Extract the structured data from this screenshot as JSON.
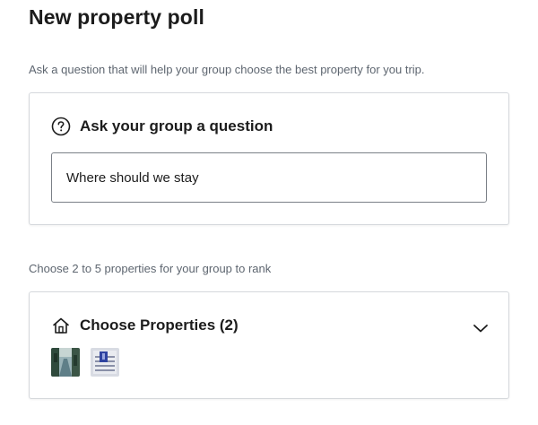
{
  "page": {
    "title": "New property poll",
    "subtitle": "Ask a question that will help your group choose the best property for you trip."
  },
  "question_card": {
    "heading": "Ask your group a question",
    "icon": "question-circle-icon",
    "input_value": "Where should we stay"
  },
  "properties_hint": "Choose 2 to 5 properties for your group to rank",
  "properties_card": {
    "heading": "Choose Properties (2)",
    "icon": "home-icon",
    "expand_icon": "chevron-down-icon",
    "thumbnails": [
      {
        "name": "property-thumbnail-1",
        "colors": [
          "#2e4a3d",
          "#6f8f9a"
        ]
      },
      {
        "name": "property-thumbnail-2",
        "colors": [
          "#3a4ea0",
          "#c9ccd6"
        ]
      }
    ]
  }
}
